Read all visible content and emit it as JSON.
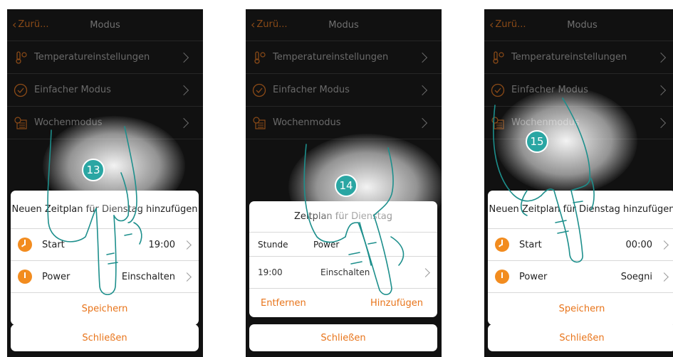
{
  "navbar": {
    "back_label": "Zurü...",
    "title": "Modus"
  },
  "menu": [
    {
      "label": "Temperatureinstellungen",
      "icon": "thermometer-icon"
    },
    {
      "label": "Einfacher Modus",
      "icon": "checkmark-circle-icon"
    },
    {
      "label": "Wochenmodus",
      "icon": "calendar-clock-icon"
    }
  ],
  "phone1": {
    "step": "13",
    "sheet_title": "Neuen Zeitplan für Dienstag hinzufügen",
    "rows": [
      {
        "label": "Start",
        "value": "19:00",
        "icon": "clock-icon"
      },
      {
        "label": "Power",
        "value": "Einschalten",
        "icon": "power-icon"
      }
    ],
    "action": "Speichern",
    "close": "Schließen"
  },
  "phone2": {
    "step": "14",
    "sheet_title": "Zeitplan für Dienstag",
    "headers": [
      "Stunde",
      "Power"
    ],
    "row": {
      "time": "19:00",
      "power": "Einschalten"
    },
    "remove": "Entfernen",
    "add": "Hinzufügen",
    "close": "Schließen"
  },
  "phone3": {
    "step": "15",
    "sheet_title": "Neuen Zeitplan für Dienstag hinzufügen",
    "rows": [
      {
        "label": "Start",
        "value": "00:00",
        "icon": "clock-icon"
      },
      {
        "label": "Power",
        "value": "Soegni",
        "icon": "power-icon"
      }
    ],
    "action": "Speichern",
    "close": "Schließen"
  },
  "colors": {
    "accent": "#e8741a",
    "badge": "#2aa6a3",
    "hand_outline": "#1d8f8c",
    "background": "#111111"
  }
}
